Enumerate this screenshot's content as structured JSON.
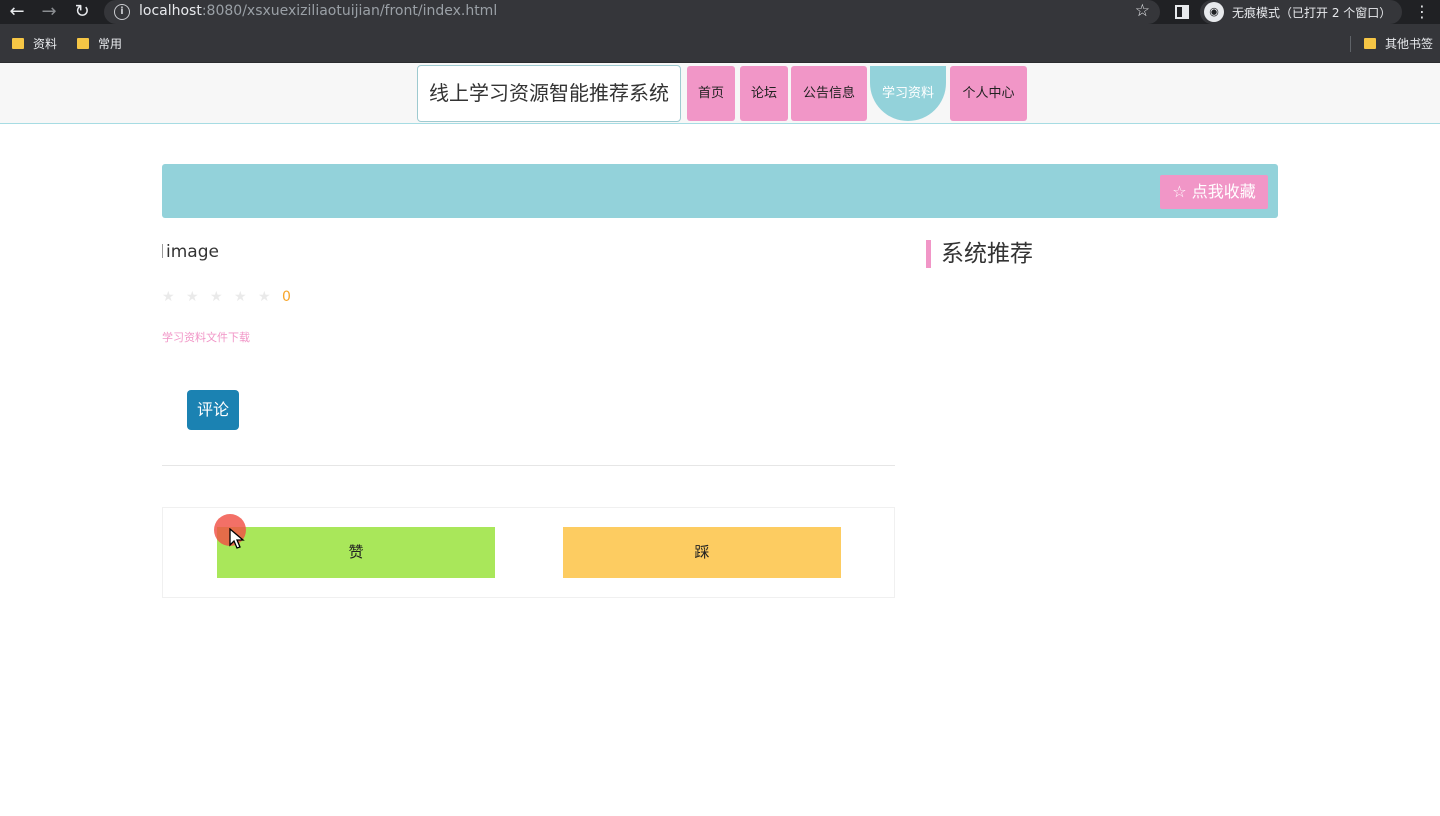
{
  "browser": {
    "url_host": "localhost",
    "url_rest": ":8080/xsxuexiziliaotuijian/front/index.html",
    "incognito_text": "无痕模式（已打开 2 个窗口）",
    "bookmarks": [
      {
        "label": "资料"
      },
      {
        "label": "常用"
      }
    ],
    "other_bookmarks": "其他书签"
  },
  "header": {
    "brand": "线上学习资源智能推荐系统",
    "nav": [
      {
        "label": "首页"
      },
      {
        "label": "论坛"
      },
      {
        "label": "公告信息"
      },
      {
        "label": "学习资料",
        "active": true
      },
      {
        "label": "个人中心"
      }
    ]
  },
  "detail": {
    "favorite_label": "☆ 点我收藏",
    "image_alt": "image",
    "rating_value": "0",
    "download_link": "学习资料文件下载",
    "comment_label": "评论",
    "like_label": "赞",
    "dislike_label": "踩"
  },
  "sidebar": {
    "title": "系统推荐"
  },
  "colors": {
    "accent_pink": "#f196c7",
    "accent_teal": "#93d2da",
    "comment_blue": "#1b82b2",
    "like_green": "#a9e75a",
    "dislike_yellow": "#fdcc61"
  }
}
